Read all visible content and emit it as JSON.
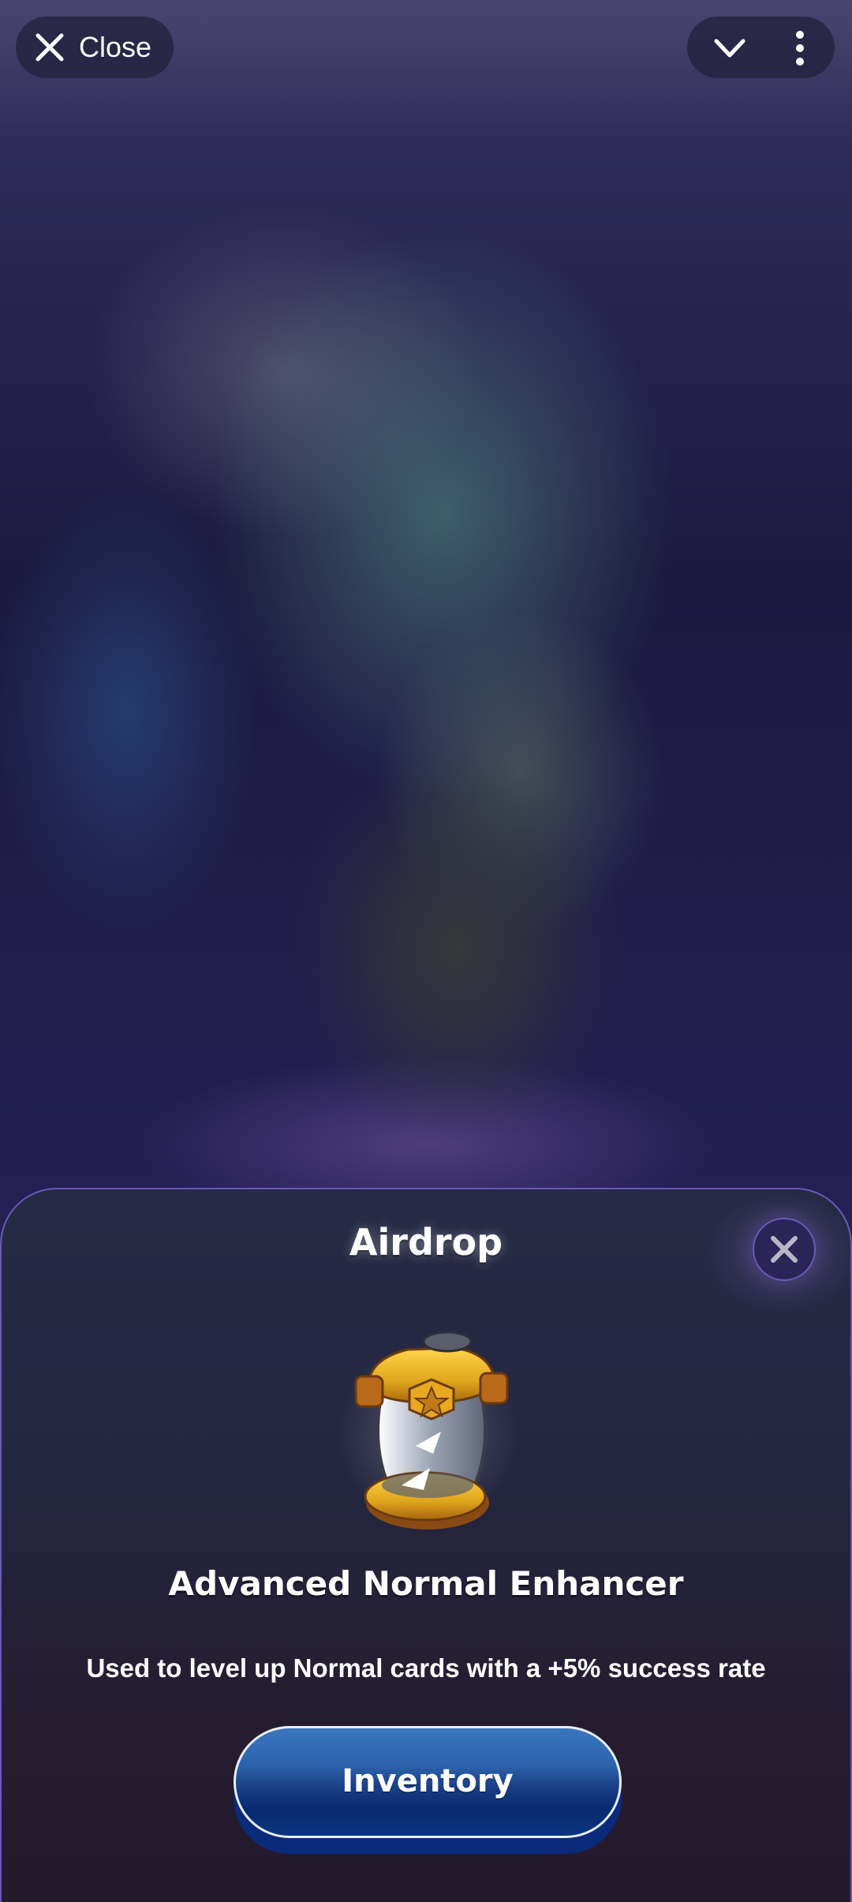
{
  "topbar": {
    "close_label": "Close"
  },
  "sheet": {
    "title": "Airdrop",
    "item_name": "Advanced Normal Enhancer",
    "item_description": "Used to level up Normal cards with a +5% success rate",
    "button_label": "Inventory"
  },
  "icons": {
    "close": "close-icon",
    "collapse": "chevron-down-icon",
    "more": "more-vertical-icon",
    "dismiss": "close-icon",
    "item": "enhancer-potion-icon"
  },
  "colors": {
    "sheet_border": "#6a58b8",
    "button_top": "#3a76c0",
    "button_bottom": "#0a3580",
    "item_gold": "#e0a61c"
  }
}
